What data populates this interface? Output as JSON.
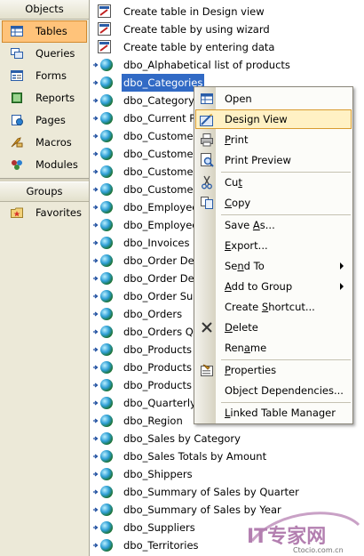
{
  "nav": {
    "objects_header": "Objects",
    "items": [
      {
        "label": "Tables",
        "icon": "tables-icon",
        "selected": true
      },
      {
        "label": "Queries",
        "icon": "queries-icon"
      },
      {
        "label": "Forms",
        "icon": "forms-icon"
      },
      {
        "label": "Reports",
        "icon": "reports-icon"
      },
      {
        "label": "Pages",
        "icon": "pages-icon"
      },
      {
        "label": "Macros",
        "icon": "macros-icon"
      },
      {
        "label": "Modules",
        "icon": "modules-icon"
      }
    ],
    "groups_header": "Groups",
    "favorites": "Favorites"
  },
  "objects": {
    "shortcuts": [
      "Create table in Design view",
      "Create table by using wizard",
      "Create table by entering data"
    ],
    "tables": [
      "dbo_Alphabetical list of products",
      "dbo_Categories",
      "dbo_Category",
      "dbo_Current Pr",
      "dbo_Customer",
      "dbo_Customer",
      "dbo_Customer",
      "dbo_Customer",
      "dbo_Employee",
      "dbo_Employee",
      "dbo_Invoices",
      "dbo_Order Det",
      "dbo_Order Det",
      "dbo_Order Sub",
      "dbo_Orders",
      "dbo_Orders Qr",
      "dbo_Products",
      "dbo_Products A",
      "dbo_Products I",
      "dbo_Quarterly",
      "dbo_Region",
      "dbo_Sales by Category",
      "dbo_Sales Totals by Amount",
      "dbo_Shippers",
      "dbo_Summary of Sales by Quarter",
      "dbo_Summary of Sales by Year",
      "dbo_Suppliers",
      "dbo_Territories"
    ],
    "selected_table": "dbo_Categories"
  },
  "context_menu": {
    "open": "Open",
    "design_view": "Design View",
    "print": "Print",
    "print_preview": "Print Preview",
    "cut": "Cut",
    "copy": "Copy",
    "save_as": "Save As...",
    "export": "Export...",
    "send_to": "Send To",
    "add_to_group": "Add to Group",
    "create_shortcut": "Create Shortcut...",
    "delete": "Delete",
    "rename": "Rename",
    "properties": "Properties",
    "object_dependencies": "Object Dependencies...",
    "linked_table_manager": "Linked Table Manager"
  },
  "watermark": {
    "brand": "IT专家网",
    "site": "Ctocio.com.cn"
  },
  "colors": {
    "selection": "#316ac5",
    "menu_hover": "#fff1c4",
    "nav_selected": "#ffc37a",
    "nav_bg": "#ece9d8"
  }
}
